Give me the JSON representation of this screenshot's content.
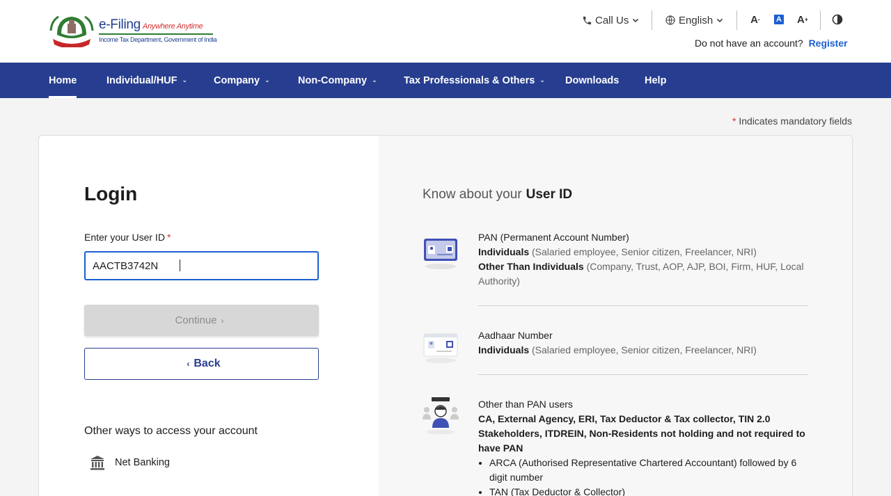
{
  "header": {
    "logo_title": "e-Filing",
    "logo_tagline": "Anywhere Anytime",
    "logo_subtitle": "Income Tax Department, Government of India",
    "call_us": "Call Us",
    "language": "English",
    "font_decrease": "A",
    "font_normal": "A",
    "font_increase": "A",
    "account_prompt": "Do not have an account?",
    "register": "Register"
  },
  "nav": {
    "items": [
      {
        "label": "Home",
        "has_dropdown": false,
        "active": true
      },
      {
        "label": "Individual/HUF",
        "has_dropdown": true
      },
      {
        "label": "Company",
        "has_dropdown": true
      },
      {
        "label": "Non-Company",
        "has_dropdown": true
      },
      {
        "label": "Tax Professionals & Others",
        "has_dropdown": true
      },
      {
        "label": "Downloads",
        "has_dropdown": false
      },
      {
        "label": "Help",
        "has_dropdown": false
      }
    ]
  },
  "mandatory_note": {
    "star": "*",
    "text": "Indicates mandatory fields"
  },
  "login": {
    "title": "Login",
    "userid_label": "Enter your User ID",
    "required_star": "*",
    "userid_value": "AACTB3742N",
    "continue_label": "Continue",
    "back_label": "Back",
    "other_ways_label": "Other ways to access your account",
    "net_banking_label": "Net Banking"
  },
  "know_userid": {
    "title_prefix": "Know about your",
    "title_bold": "User ID",
    "pan": {
      "title": "PAN (Permanent Account Number)",
      "individuals_label": "Individuals",
      "individuals_desc": "(Salaried employee, Senior citizen, Freelancer, NRI)",
      "others_label": "Other Than Individuals",
      "others_desc": "(Company, Trust, AOP, AJP, BOI, Firm, HUF, Local Authority)"
    },
    "aadhaar": {
      "title": "Aadhaar Number",
      "individuals_label": "Individuals",
      "individuals_desc": "(Salaried employee, Senior citizen, Freelancer, NRI)"
    },
    "other_than_pan": {
      "title": "Other than PAN users",
      "users_bold": "CA, External Agency, ERI, Tax Deductor & Tax collector, TIN 2.0 Stakeholders, ITDREIN, Non-Residents not holding and not required to have PAN",
      "bullets": [
        "ARCA (Authorised Representative Chartered Accountant) followed by 6 digit number",
        "TAN (Tax Deductor & Collector)"
      ]
    }
  },
  "colors": {
    "nav_bg": "#273d8f",
    "link_blue": "#1c5fd1",
    "required_red": "#d32f2f",
    "disabled_btn": "#d7d7d7",
    "emblem_green": "#2e7d32"
  },
  "icons": [
    "phone-icon",
    "globe-icon",
    "chevron-down-icon",
    "contrast-icon",
    "chevron-right-icon",
    "chevron-left-icon",
    "bank-icon",
    "pan-card-icon",
    "aadhaar-card-icon",
    "users-icon"
  ]
}
